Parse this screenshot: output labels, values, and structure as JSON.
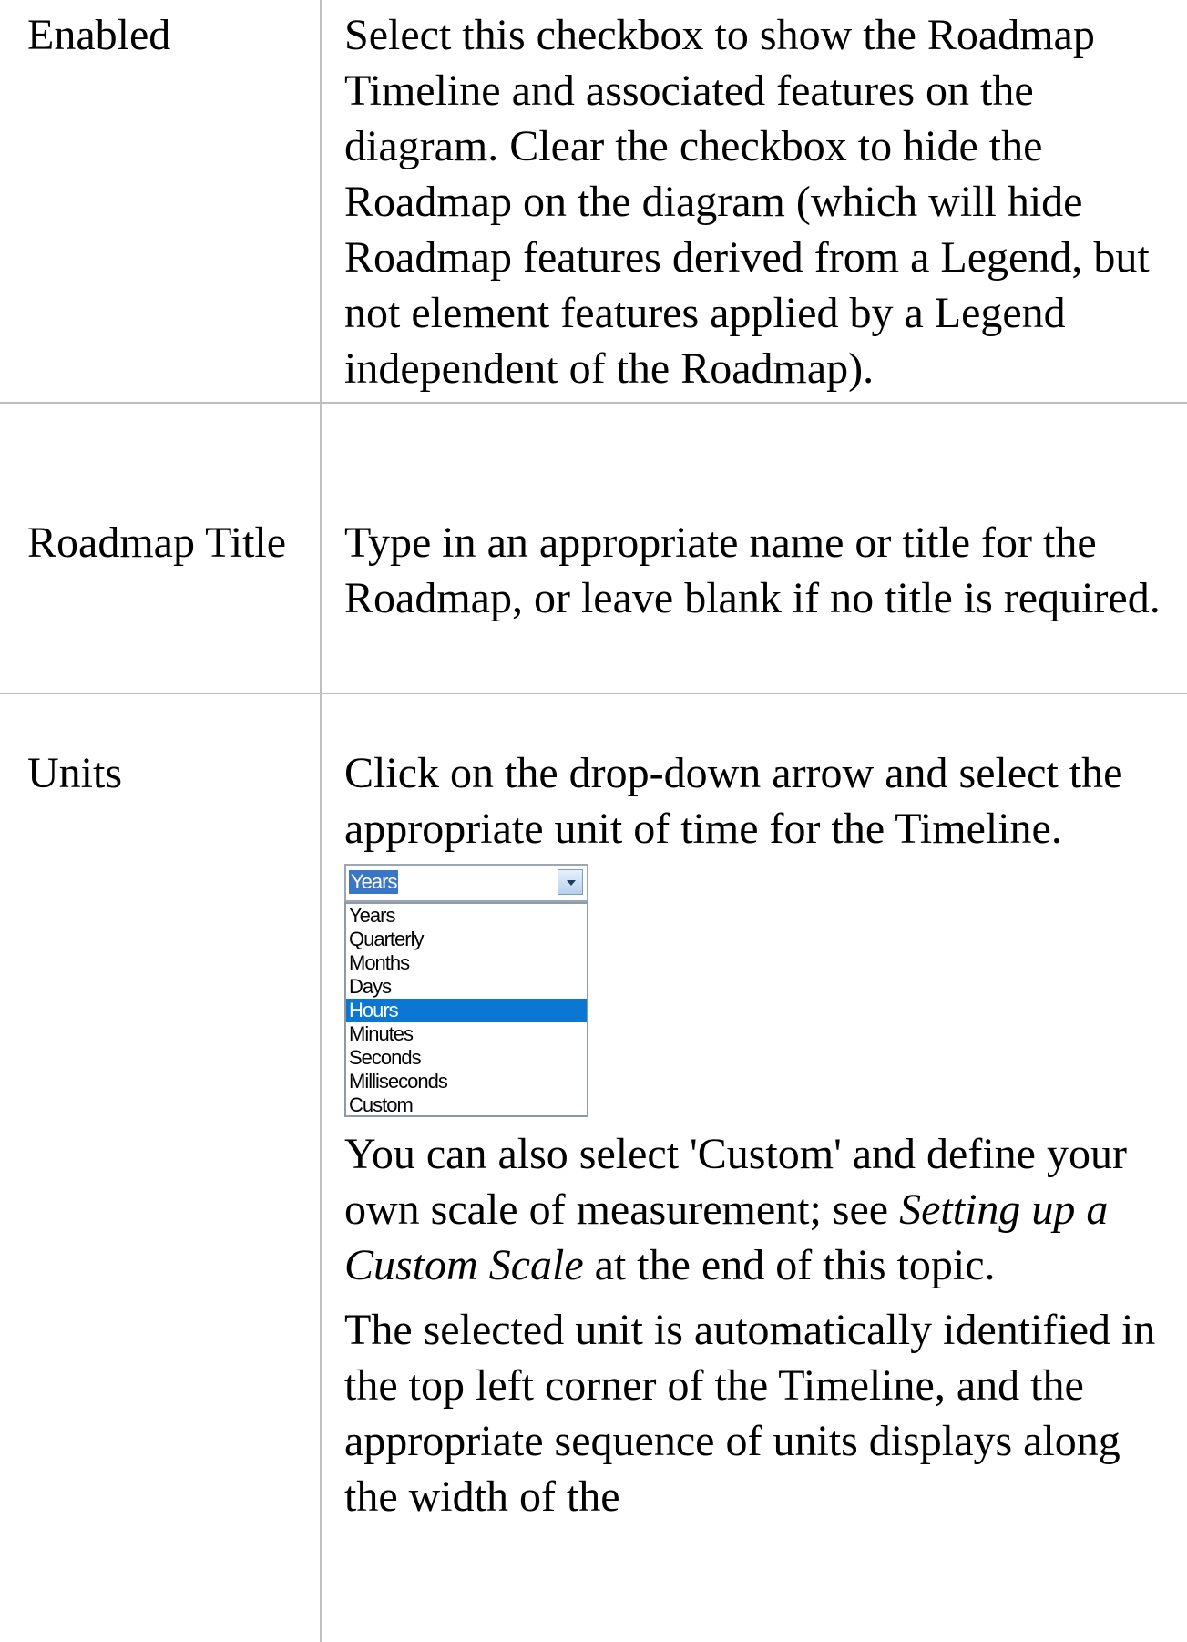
{
  "rows": [
    {
      "label": "Enabled",
      "description": "Select this checkbox to show the Roadmap Timeline and associated features on the diagram. Clear the checkbox to hide the Roadmap on the diagram (which will hide Roadmap features derived from a Legend, but not element features applied by a Legend independent of the Roadmap)."
    },
    {
      "label": "Roadmap Title",
      "description": "Type in an appropriate name or title for the Roadmap, or leave blank if no title is required."
    },
    {
      "label": "Units",
      "description_intro": "Click on the drop-down arrow and select the appropriate unit of time for the Timeline.",
      "custom_note_before": "You can also select 'Custom' and define your own scale of measurement; see ",
      "custom_note_link": "Setting up a Custom Scale",
      "custom_note_after": " at the end of this topic.",
      "selected_unit_note": "The selected unit is automatically identified in the top left corner of the Timeline, and the appropriate sequence of units displays along the width of the"
    }
  ],
  "units_dropdown": {
    "current_value": "Years",
    "highlighted_option": "Hours",
    "options": [
      "Years",
      "Quarterly",
      "Months",
      "Days",
      "Hours",
      "Minutes",
      "Seconds",
      "Milliseconds",
      "Custom"
    ]
  }
}
